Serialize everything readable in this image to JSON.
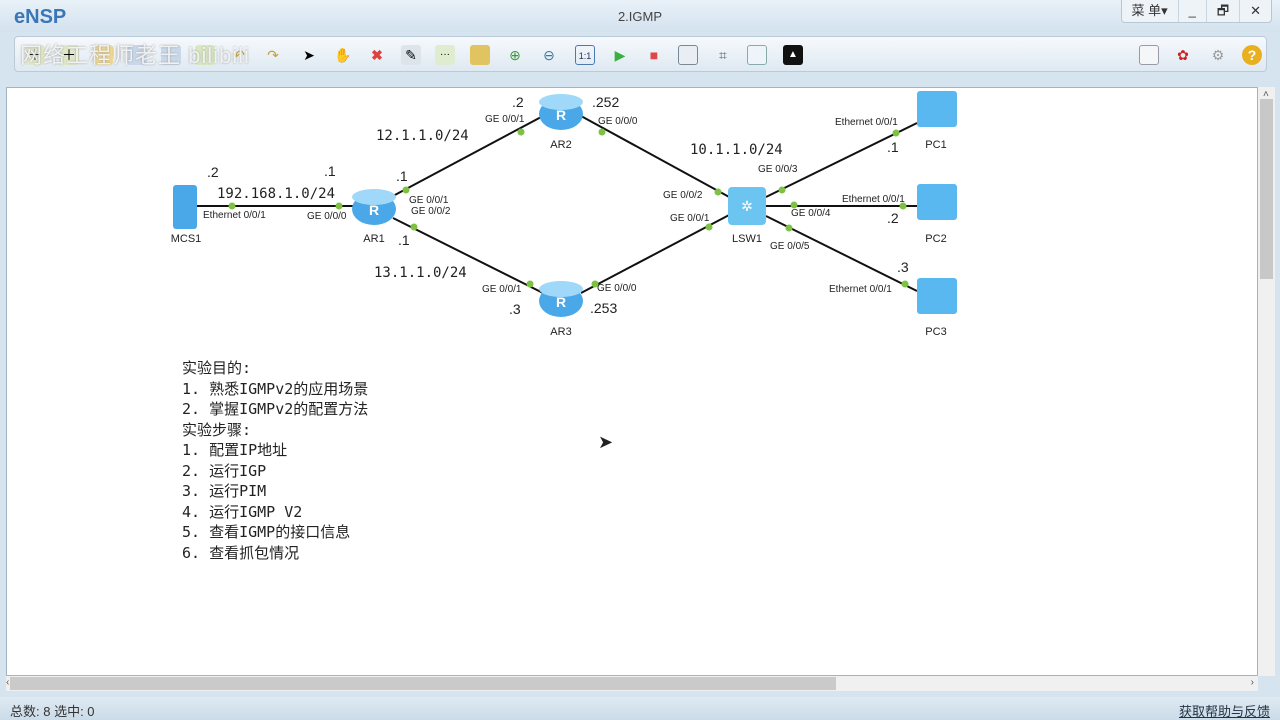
{
  "app": {
    "name": "eNSP",
    "title": "2.IGMP",
    "menu_label": "菜 单▾",
    "minimize": "_",
    "restore": "🗗",
    "close": "✕"
  },
  "watermark": "网络工程师老王 bilibili",
  "toolbar": {
    "icons": [
      "new-topo",
      "new-topo-alt",
      "open",
      "save",
      "save-as",
      "print",
      "undo",
      "redo",
      "select",
      "hand",
      "delete",
      "delete-link",
      "text",
      "palette",
      "zoom-in",
      "zoom-out",
      "fit",
      "start",
      "stop",
      "capture",
      "topology",
      "grid",
      "terminal"
    ],
    "right_icons": [
      "chat",
      "huawei",
      "settings",
      "help"
    ]
  },
  "topology": {
    "devices": {
      "mcs1": "MCS1",
      "ar1": "AR1",
      "ar2": "AR2",
      "ar3": "AR3",
      "lsw1": "LSW1",
      "pc1": "PC1",
      "pc2": "PC2",
      "pc3": "PC3"
    },
    "subnets": {
      "s1": "192.168.1.0/24",
      "s2": "12.1.1.0/24",
      "s3": "13.1.1.0/24",
      "s4": "10.1.1.0/24"
    },
    "ips": {
      "mcs1": ".2",
      "ar1_g0": ".1",
      "ar1_g1": ".1",
      "ar1_g2": ".1",
      "ar2_g1": ".2",
      "ar2_g0": ".252",
      "ar3_g1": ".3",
      "ar3_g0": ".253",
      "pc1": ".1",
      "pc2": ".2",
      "pc3": ".3"
    },
    "ports": {
      "mcs1_e": "Ethernet 0/0/1",
      "ar1_g0": "GE 0/0/0",
      "ar1_g1": "GE 0/0/1",
      "ar1_g2": "GE 0/0/2",
      "ar2_g1": "GE 0/0/1",
      "ar2_g0": "GE 0/0/0",
      "ar3_g1": "GE 0/0/1",
      "ar3_g0": "GE 0/0/0",
      "lsw_g2": "GE 0/0/2",
      "lsw_g1": "GE 0/0/1",
      "lsw_g3": "GE 0/0/3",
      "lsw_g4": "GE 0/0/4",
      "lsw_g5": "GE 0/0/5",
      "pc1_e": "Ethernet 0/0/1",
      "pc2_e": "Ethernet 0/0/1",
      "pc3_e": "Ethernet 0/0/1"
    }
  },
  "notes": [
    "实验目的:",
    "1. 熟悉IGMPv2的应用场景",
    "2. 掌握IGMPv2的配置方法",
    "实验步骤:",
    "1. 配置IP地址",
    "2. 运行IGP",
    "3. 运行PIM",
    "4. 运行IGMP V2",
    "5. 查看IGMP的接口信息",
    "6. 查看抓包情况"
  ],
  "status": {
    "counts": "总数: 8 选中: 0",
    "help_link": "获取帮助与反馈"
  },
  "colors": {
    "port_dot": "#7dc242",
    "device": "#4aa8e8"
  }
}
